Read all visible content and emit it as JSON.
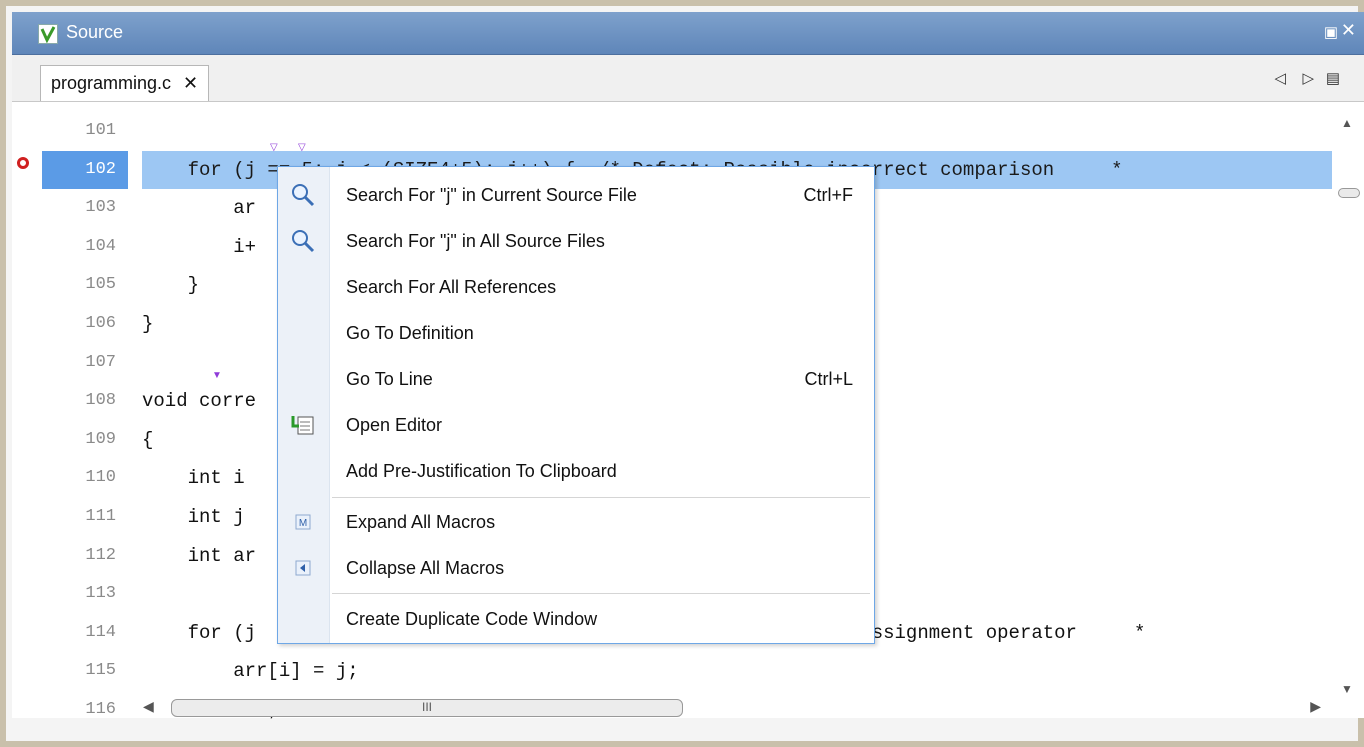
{
  "window": {
    "title": "Source",
    "restore_label": "▣",
    "close_label": "✕"
  },
  "tab": {
    "label": "programming.c",
    "close": "✕"
  },
  "tab_nav": {
    "prev": "◁",
    "next": "▷",
    "list": "▤"
  },
  "gutter": {
    "lines": [
      "101",
      "102",
      "103",
      "104",
      "105",
      "106",
      "107",
      "108",
      "109",
      "110",
      "111",
      "112",
      "113",
      "114",
      "115",
      "116"
    ],
    "active_line": "102"
  },
  "code": {
    "lines": [
      "",
      "    for (j == 5; j < (SIZE4+5); j++) {  /* Defect: Possible incorrect comparison     *",
      "        ar",
      "        i+",
      "    }",
      "}",
      "",
      "void corre",
      "{",
      "    int i",
      "    int j",
      "    int ar",
      "",
      "    for (j                                              proper assignment operator     *",
      "        arr[i] = j;",
      "        i++;"
    ]
  },
  "context_menu": {
    "items": [
      {
        "label": "Search For \"j\" in Current Source File",
        "shortcut": "Ctrl+F",
        "icon": "search-icon"
      },
      {
        "label": "Search For \"j\" in All Source Files",
        "shortcut": "",
        "icon": "search-icon"
      },
      {
        "label": "Search For All References",
        "shortcut": "",
        "icon": ""
      },
      {
        "label": "Go To Definition",
        "shortcut": "",
        "icon": ""
      },
      {
        "label": "Go To Line",
        "shortcut": "Ctrl+L",
        "icon": ""
      },
      {
        "label": "Open Editor",
        "shortcut": "",
        "icon": "open-editor-icon"
      },
      {
        "label": "Add Pre-Justification To Clipboard",
        "shortcut": "",
        "icon": ""
      },
      {
        "label": "Expand All Macros",
        "shortcut": "",
        "icon": "expand-macro-icon"
      },
      {
        "label": "Collapse All Macros",
        "shortcut": "",
        "icon": "collapse-macro-icon"
      },
      {
        "label": "Create Duplicate Code Window",
        "shortcut": "",
        "icon": ""
      }
    ]
  },
  "scroll": {
    "h_thumb_label": "III"
  },
  "colors": {
    "title_bar": "#6a8fc0",
    "selected_line": "#9dc7f3",
    "active_gutter": "#5b9be6",
    "breakpoint": "#d02020",
    "marker": "#8e3bd8"
  }
}
